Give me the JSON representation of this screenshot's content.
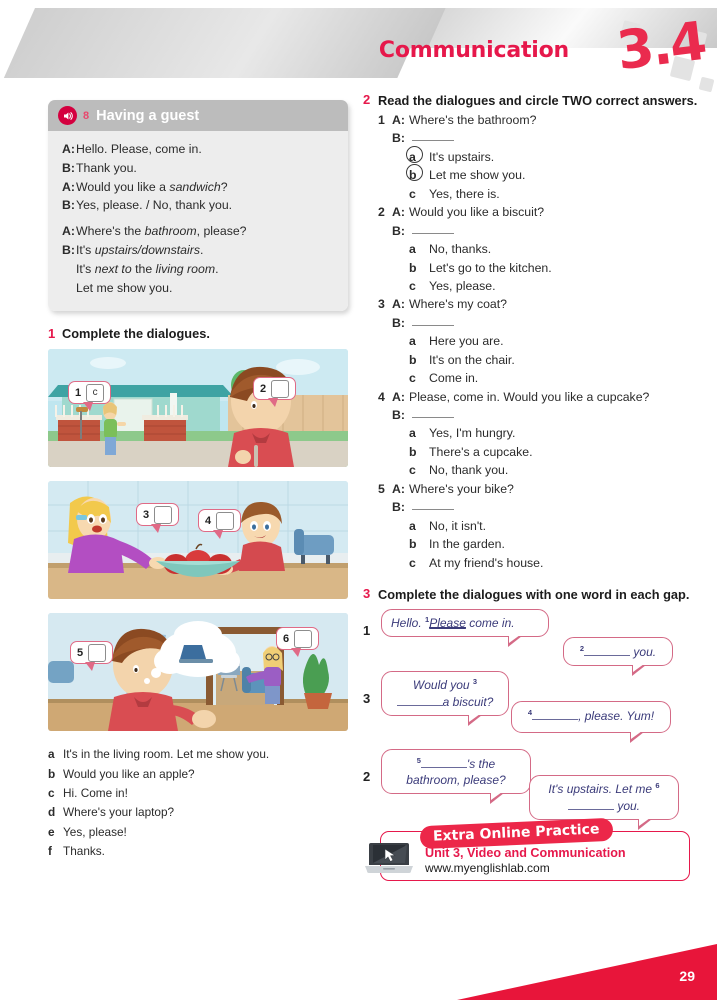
{
  "header": {
    "title": "Communication",
    "unit_number": "3.4"
  },
  "model_box": {
    "icon": "speaker-icon",
    "track_number": "8",
    "title": "Having a guest",
    "lines": [
      {
        "speaker": "A:",
        "parts": [
          {
            "t": "Hello. Please, come in.",
            "i": false
          }
        ]
      },
      {
        "speaker": "B:",
        "parts": [
          {
            "t": "Thank you.",
            "i": false
          }
        ]
      },
      {
        "speaker": "A:",
        "parts": [
          {
            "t": "Would you like a ",
            "i": false
          },
          {
            "t": "sandwich",
            "i": true
          },
          {
            "t": "?",
            "i": false
          }
        ]
      },
      {
        "speaker": "B:",
        "parts": [
          {
            "t": "Yes, please. / No, thank you.",
            "i": false
          }
        ]
      },
      {
        "speaker": "",
        "parts": [],
        "spacer": true
      },
      {
        "speaker": "A:",
        "parts": [
          {
            "t": "Where's the ",
            "i": false
          },
          {
            "t": "bathroom",
            "i": true
          },
          {
            "t": ", please?",
            "i": false
          }
        ]
      },
      {
        "speaker": "B:",
        "parts": [
          {
            "t": "It's ",
            "i": false
          },
          {
            "t": "upstairs/downstairs",
            "i": true
          },
          {
            "t": ".",
            "i": false
          }
        ]
      },
      {
        "speaker": "",
        "indent": true,
        "parts": [
          {
            "t": "It's ",
            "i": false
          },
          {
            "t": "next to",
            "i": true
          },
          {
            "t": " the ",
            "i": false
          },
          {
            "t": "living room",
            "i": true
          },
          {
            "t": ".",
            "i": false
          }
        ]
      },
      {
        "speaker": "",
        "indent": true,
        "parts": [
          {
            "t": "Let me show you.",
            "i": false
          }
        ]
      }
    ]
  },
  "exercise1": {
    "number": "1",
    "instruction": "Complete the dialogues.",
    "pictures": [
      {
        "scene": "two-kids-outside-house",
        "bubbles": [
          {
            "number": "1",
            "answer": "c"
          },
          {
            "number": "2",
            "answer": ""
          }
        ]
      },
      {
        "scene": "girl-offering-apples-in-kitchen",
        "bubbles": [
          {
            "number": "3",
            "answer": ""
          },
          {
            "number": "4",
            "answer": ""
          }
        ]
      },
      {
        "scene": "boy-thinking-of-laptop-girl-in-doorway",
        "bubbles": [
          {
            "number": "5",
            "answer": ""
          },
          {
            "number": "6",
            "answer": ""
          }
        ]
      }
    ],
    "options": [
      {
        "key": "a",
        "text": "It's in the living room. Let me show you."
      },
      {
        "key": "b",
        "text": "Would you like an apple?"
      },
      {
        "key": "c",
        "text": "Hi. Come in!"
      },
      {
        "key": "d",
        "text": "Where's your laptop?"
      },
      {
        "key": "e",
        "text": "Yes, please!"
      },
      {
        "key": "f",
        "text": "Thanks."
      }
    ]
  },
  "exercise2": {
    "number": "2",
    "instruction": "Read the dialogues and circle TWO correct answers.",
    "items": [
      {
        "number": "1",
        "question": "Where's the bathroom?",
        "answers": [
          {
            "key": "a",
            "text": "It's upstairs.",
            "circled": true
          },
          {
            "key": "b",
            "text": "Let me show you.",
            "circled": true
          },
          {
            "key": "c",
            "text": "Yes, there is.",
            "circled": false
          }
        ]
      },
      {
        "number": "2",
        "question": "Would you like a biscuit?",
        "answers": [
          {
            "key": "a",
            "text": "No, thanks.",
            "circled": false
          },
          {
            "key": "b",
            "text": "Let's go to the kitchen.",
            "circled": false
          },
          {
            "key": "c",
            "text": "Yes, please.",
            "circled": false
          }
        ]
      },
      {
        "number": "3",
        "question": "Where's my coat?",
        "answers": [
          {
            "key": "a",
            "text": "Here you are.",
            "circled": false
          },
          {
            "key": "b",
            "text": "It's on the chair.",
            "circled": false
          },
          {
            "key": "c",
            "text": "Come in.",
            "circled": false
          }
        ]
      },
      {
        "number": "4",
        "question": "Please, come in. Would you like a cupcake?",
        "answers": [
          {
            "key": "a",
            "text": "Yes, I'm hungry.",
            "circled": false
          },
          {
            "key": "b",
            "text": "There's a cupcake.",
            "circled": false
          },
          {
            "key": "c",
            "text": "No, thank you.",
            "circled": false
          }
        ]
      },
      {
        "number": "5",
        "question": "Where's your bike?",
        "answers": [
          {
            "key": "a",
            "text": "No, it isn't.",
            "circled": false
          },
          {
            "key": "b",
            "text": "In the garden.",
            "circled": false
          },
          {
            "key": "c",
            "text": "At my friend's house.",
            "circled": false
          }
        ]
      }
    ],
    "speaker_a": "A:",
    "speaker_b": "B:"
  },
  "exercise3": {
    "number": "3",
    "instruction": "Complete the dialogues with one word in each gap.",
    "dialogues": [
      {
        "number": "1",
        "bubble_a": {
          "pre": "Hello. ",
          "sup": "1",
          "filled": "Please",
          "post": "  come in."
        },
        "bubble_b": {
          "sup": "2",
          "post": " you."
        }
      },
      {
        "number": "3",
        "bubble_a": {
          "pre": "Would you ",
          "sup": "3",
          "post": "a biscuit?"
        },
        "bubble_b": {
          "sup": "4",
          "post": ", please. Yum!"
        }
      },
      {
        "number": "2",
        "bubble_a": {
          "sup": "5",
          "post": "'s  the bathroom, please?"
        },
        "bubble_b": {
          "pre": "It's upstairs. Let me ",
          "sup": "6",
          "post": " you."
        }
      }
    ]
  },
  "extra_online": {
    "icon": "laptop-cursor-icon",
    "tag": "Extra Online Practice",
    "line1": "Unit 3, Video and Communication",
    "line2": "www.myenglishlab.com"
  },
  "page_number": "29",
  "colors": {
    "accent_red": "#e6184b",
    "header_gray": "#bcbcbc",
    "bubble_pink": "#d46a86",
    "body_gray": "#ededed"
  }
}
